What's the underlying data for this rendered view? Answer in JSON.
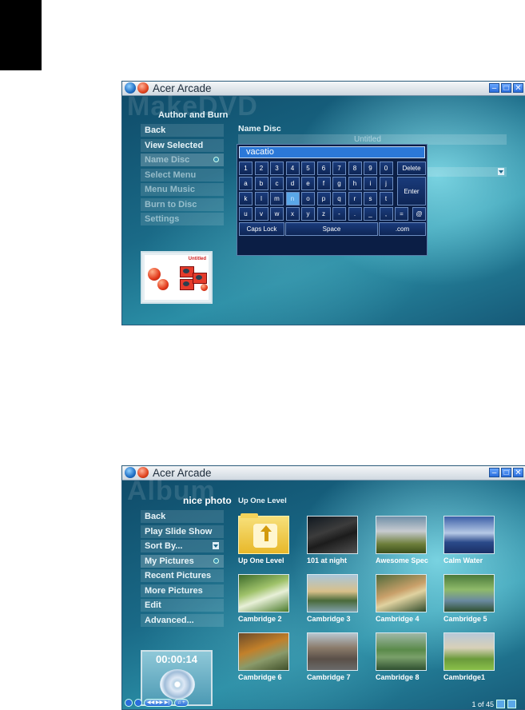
{
  "window1": {
    "title": "Acer Arcade",
    "watermark": "MakeDVD",
    "header": "Author and Burn",
    "menu": [
      {
        "label": "Back"
      },
      {
        "label": "View Selected"
      },
      {
        "label": "Name Disc"
      },
      {
        "label": "Select Menu"
      },
      {
        "label": "Menu Music"
      },
      {
        "label": "Burn to Disc"
      },
      {
        "label": "Settings"
      }
    ],
    "name_label": "Name Disc",
    "name_value": "Untitled",
    "keyboard": {
      "input_value": "vacatio",
      "rows": [
        [
          "1",
          "2",
          "3",
          "4",
          "5",
          "6",
          "7",
          "8",
          "9",
          "0"
        ],
        [
          "a",
          "b",
          "c",
          "d",
          "e",
          "f",
          "g",
          "h",
          "i",
          "j"
        ],
        [
          "k",
          "l",
          "m",
          "n",
          "o",
          "p",
          "q",
          "r",
          "s",
          "t"
        ],
        [
          "u",
          "v",
          "w",
          "x",
          "y",
          "z",
          "-",
          ".",
          "_",
          ",",
          "="
        ]
      ],
      "symbols_row1": [
        "!",
        "@",
        "#",
        "$",
        "%",
        "^",
        "&",
        "*",
        "(",
        ")"
      ],
      "symbols_row4": [
        "",
        "",
        "",
        "",
        "",
        "",
        "",
        "",
        "",
        "",
        "+"
      ],
      "delete_label": "Delete",
      "enter_label": "Enter",
      "at_label": "@",
      "capslock_label": "Caps Lock",
      "space_label": "Space",
      "dotcom_label": ".com",
      "selected_key": "n"
    },
    "thumbnail_label": "Untitled"
  },
  "window2": {
    "title": "Acer Arcade",
    "watermark": "Album",
    "folder_name": "nice photo",
    "up_label": "Up One Level",
    "menu": [
      {
        "label": "Back"
      },
      {
        "label": "Play Slide Show"
      },
      {
        "label": "Sort By..."
      },
      {
        "label": "My Pictures"
      },
      {
        "label": "Recent Pictures"
      },
      {
        "label": "More Pictures"
      },
      {
        "label": "Edit"
      },
      {
        "label": "Advanced..."
      }
    ],
    "timer": "00:00:14",
    "items": [
      {
        "label": "Up One Level"
      },
      {
        "label": "101 at night"
      },
      {
        "label": "Awesome Spec"
      },
      {
        "label": "Calm Water"
      },
      {
        "label": "Cambridge 2"
      },
      {
        "label": "Cambridge 3"
      },
      {
        "label": "Cambridge 4"
      },
      {
        "label": "Cambridge 5"
      },
      {
        "label": "Cambridge 6"
      },
      {
        "label": "Cambridge 7"
      },
      {
        "label": "Cambridge 8"
      },
      {
        "label": "Cambridge1"
      }
    ],
    "page_count": "1 of 45"
  },
  "colors": {
    "accent": "#2b78d8",
    "stage_dark": "#0f4c6a",
    "stage_light": "#2a8ea6",
    "caption": "#ffffff"
  }
}
